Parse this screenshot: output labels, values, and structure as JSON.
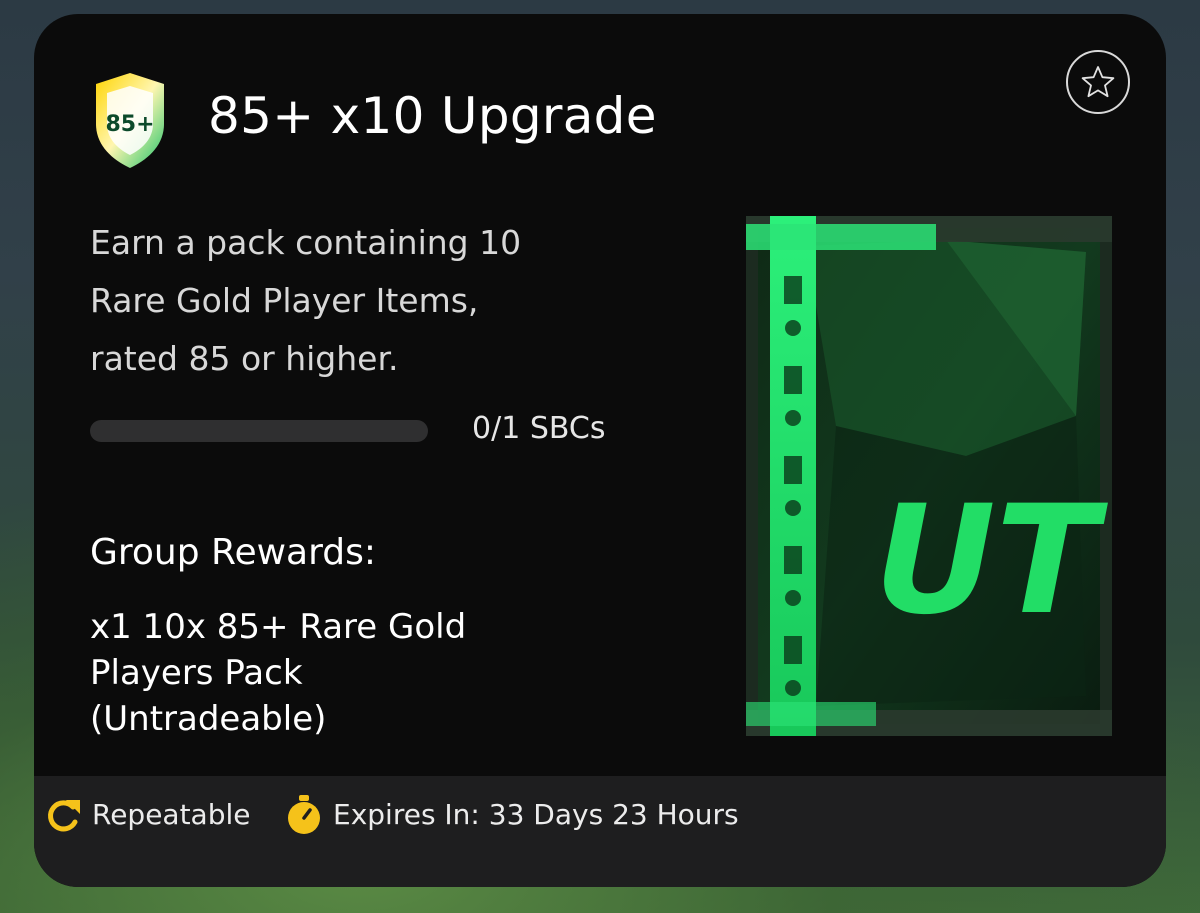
{
  "colors": {
    "accent_gold": "#f5c21a",
    "pack_green": "#22dd66",
    "card_bg": "#0b0b0b",
    "footer_bg": "#1e1e1f"
  },
  "sbc": {
    "badge": {
      "label": "85+",
      "icon": "rating-shield-icon"
    },
    "title": "85+ x10 Upgrade",
    "favorite_icon": "star-icon",
    "description": "Earn a pack containing 10\nRare Gold Player Items,\nrated 85 or higher.",
    "progress": {
      "completed": 0,
      "total": 1,
      "fraction": 0,
      "label": "0/1 SBCs"
    },
    "rewards": {
      "heading": "Group Rewards:",
      "items": [
        {
          "label": "x1 10x 85+ Rare Gold\nPlayers Pack\n(Untradeable)"
        }
      ]
    },
    "pack": {
      "icon": "pack-icon",
      "logo_text": "UT"
    }
  },
  "footer": {
    "repeatable": {
      "icon": "repeat-icon",
      "label": "Repeatable"
    },
    "expires": {
      "icon": "stopwatch-icon",
      "label": "Expires In: 33 Days 23 Hours"
    }
  }
}
